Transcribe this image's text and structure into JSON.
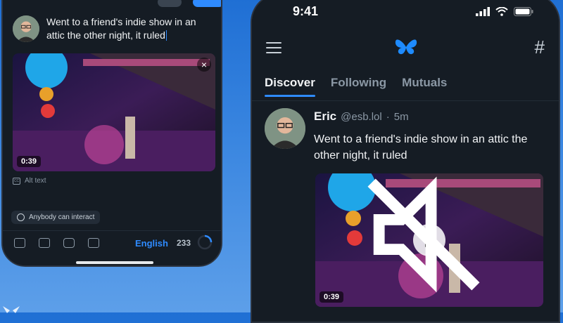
{
  "colors": {
    "accent": "#2f8bff",
    "background": "#1f6fd4",
    "screen": "#151c24"
  },
  "composer": {
    "post_text": "Went to a friend's indie show in an attic the other night, it ruled",
    "video_duration": "0:39",
    "alt_text_label": "Alt text",
    "interaction_label": "Anybody can interact",
    "language": "English",
    "char_count": "233",
    "icons": [
      "photo-icon",
      "film-icon",
      "camera-icon",
      "gif-icon"
    ]
  },
  "feed": {
    "clock": "9:41",
    "icons": [
      "menu-icon",
      "butterfly-logo-icon",
      "hashtag-icon"
    ],
    "tabs": [
      {
        "label": "Discover",
        "active": true
      },
      {
        "label": "Following",
        "active": false
      },
      {
        "label": "Mutuals",
        "active": false
      }
    ],
    "post": {
      "author": "Eric",
      "handle": "@esb.lol",
      "separator": "·",
      "time": "5m",
      "text": "Went to a friend's indie show in an attic the other night, it ruled",
      "video_duration": "0:39"
    }
  }
}
